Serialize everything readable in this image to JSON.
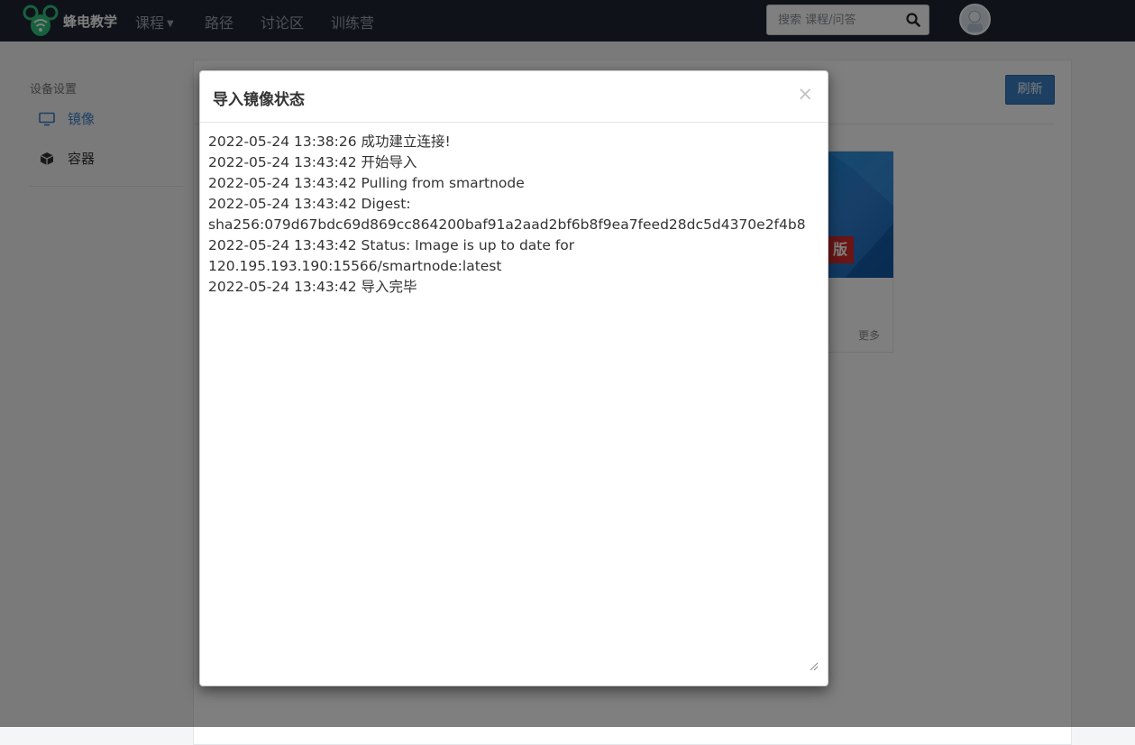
{
  "navbar": {
    "logo_text": "蜂电教学",
    "items": [
      {
        "label": "课程",
        "has_dropdown": true
      },
      {
        "label": "路径"
      },
      {
        "label": "讨论区"
      },
      {
        "label": "训练营"
      }
    ],
    "search": {
      "placeholder": "搜索 课程/问答",
      "value": ""
    }
  },
  "sidebar": {
    "title": "设备设置",
    "items": [
      {
        "label": "镜像",
        "active": true
      },
      {
        "label": "容器",
        "active": false
      }
    ]
  },
  "main": {
    "refresh_label": "刷新",
    "card": {
      "ribbon_text": "版",
      "more_label": "更多"
    }
  },
  "modal": {
    "title": "导入镜像状态",
    "close_glyph": "×",
    "log_lines": [
      "2022-05-24 13:38:26 成功建立连接!",
      "2022-05-24 13:43:42 开始导入",
      "2022-05-24 13:43:42 Pulling from smartnode",
      "2022-05-24 13:43:42 Digest:",
      "sha256:079d67bdc69d869cc864200baf91a2aad2bf6b8f9ea7feed28dc5d4370e2f4b8",
      "2022-05-24 13:43:42 Status: Image is up to date for",
      "120.195.193.190:15566/smartnode:latest",
      "2022-05-24 13:43:42 导入完毕"
    ]
  },
  "colors": {
    "navbar_bg": "#1f2430",
    "nav_text": "#9ea3ad",
    "accent_blue": "#3b7fc4",
    "overlay": "rgba(0,0,0,0.5)",
    "logo_green": "#2ec27e"
  },
  "icons": {
    "search": "search-icon",
    "monitor": "monitor-icon",
    "cube": "cube-icon",
    "close": "close-icon"
  }
}
